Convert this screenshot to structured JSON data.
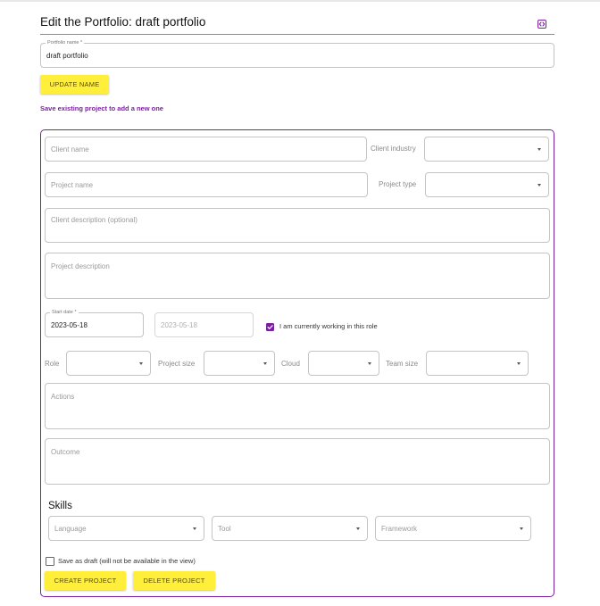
{
  "header": {
    "title": "Edit the Portfolio: draft portfolio",
    "code_icon": "code-icon",
    "accent_color": "#7b1fa2"
  },
  "portfolio_name": {
    "label": "Portfolio name *",
    "value": "draft portfolio"
  },
  "update_name_button": "UPDATE NAME",
  "save_hint": "Save existing project to add a new one",
  "project_form": {
    "client_name_placeholder": "Client name",
    "client_industry_label": "Client industry",
    "client_industry_value": "",
    "project_name_placeholder": "Project name",
    "project_type_label": "Project type",
    "project_type_value": "",
    "client_description_placeholder": "Client description (optional)",
    "project_description_placeholder": "Project description",
    "start_date_label": "Start date *",
    "start_date_value": "2023-05-18",
    "end_date_value": "2023-05-18",
    "currently_working": {
      "label": "I am currently working in this role",
      "checked": true
    },
    "role_label": "Role",
    "project_size_label": "Project size",
    "cloud_label": "Cloud",
    "team_size_label": "Team size",
    "actions_placeholder": "Actions",
    "outcome_placeholder": "Outcome",
    "skills_heading": "Skills",
    "language_placeholder": "Language",
    "tool_placeholder": "Tool",
    "framework_placeholder": "Framework",
    "save_as_draft": {
      "label": "Save as draft (will not be available in the view)",
      "checked": false
    },
    "create_button": "CREATE PROJECT",
    "delete_button": "DELETE PROJECT"
  },
  "colors": {
    "accent": "#7b1fa2",
    "button_yellow": "#ffef3a",
    "border": "#c4c4c4"
  }
}
